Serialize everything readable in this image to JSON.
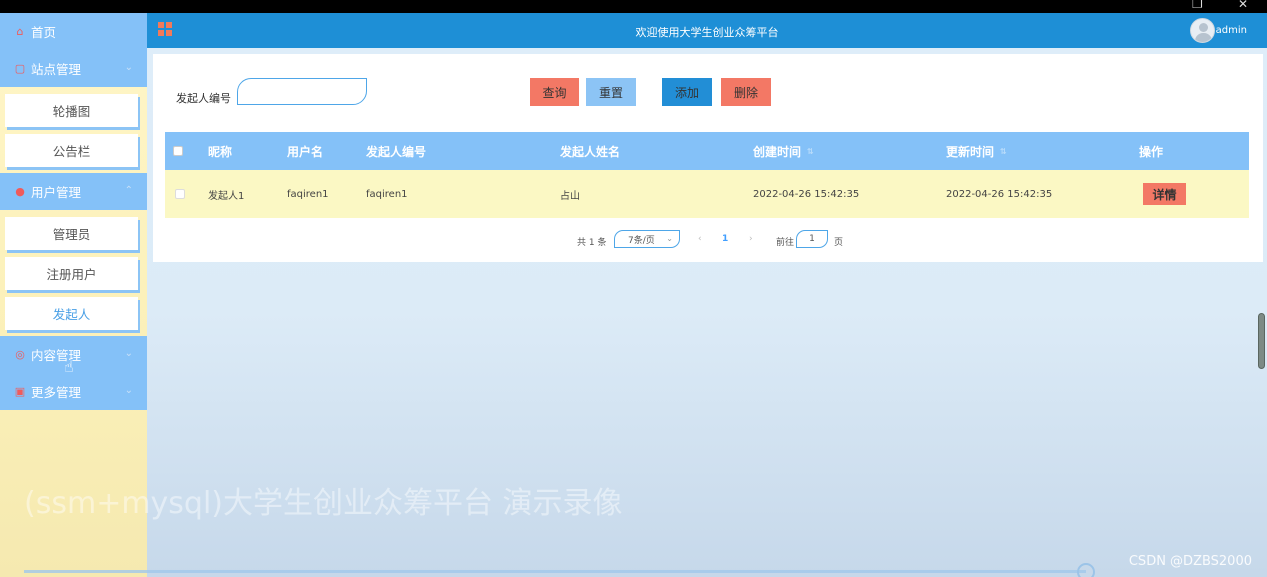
{
  "window": {
    "restore_icon": "restore-icon",
    "close_icon": "close-icon",
    "close_glyph": "✕",
    "restore_glyph": "❐"
  },
  "sidebar": {
    "menus": [
      {
        "label": "首页",
        "icon": "home-icon"
      },
      {
        "label": "站点管理",
        "icon": "site-icon"
      },
      {
        "label": "用户管理",
        "icon": "user-icon"
      },
      {
        "label": "内容管理",
        "icon": "content-icon"
      },
      {
        "label": "更多管理",
        "icon": "more-icon"
      }
    ],
    "site_items": [
      "轮播图",
      "公告栏"
    ],
    "user_items": [
      "管理员",
      "注册用户",
      "发起人"
    ]
  },
  "header": {
    "title": "欢迎使用大学生创业众筹平台",
    "username": "admin"
  },
  "search": {
    "label": "发起人编号",
    "value": ""
  },
  "buttons": {
    "query": "查询",
    "reset": "重置",
    "add": "添加",
    "delete": "删除",
    "detail": "详情"
  },
  "table": {
    "headers": [
      "昵称",
      "用户名",
      "发起人编号",
      "发起人姓名",
      "创建时间",
      "更新时间",
      "操作"
    ],
    "rows": [
      {
        "nickname": "发起人1",
        "username": "faqiren1",
        "sponsor_no": "faqiren1",
        "sponsor_name": "占山",
        "created": "2022-04-26 15:42:35",
        "updated": "2022-04-26 15:42:35"
      }
    ]
  },
  "pagination": {
    "total": "共 1 条",
    "page_size": "7条/页",
    "prev": "‹",
    "current": "1",
    "next": "›",
    "goto": "前往",
    "goto_value": "1",
    "unit": "页"
  },
  "overlay": {
    "video_title": "(ssm+mysql)大学生创业众筹平台 演示录像",
    "watermark": "CSDN @DZBS2000"
  }
}
